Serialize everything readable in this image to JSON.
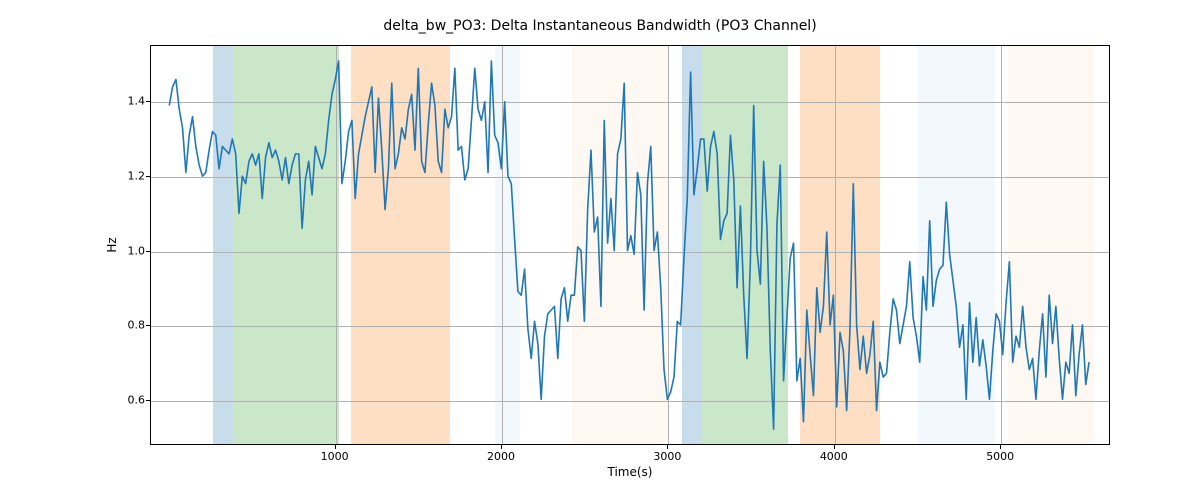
{
  "chart_data": {
    "type": "line",
    "title": "delta_bw_PO3: Delta Instantaneous Bandwidth (PO3 Channel)",
    "xlabel": "Time(s)",
    "ylabel": "Hz",
    "xlim": [
      -110,
      5660
    ],
    "ylim": [
      0.48,
      1.55
    ],
    "xticks": [
      1000,
      2000,
      3000,
      4000,
      5000
    ],
    "yticks": [
      0.6,
      0.8,
      1.0,
      1.2,
      1.4
    ],
    "bands": [
      {
        "x0": 260,
        "x1": 380,
        "color": "#1f77b4"
      },
      {
        "x0": 380,
        "x1": 1020,
        "color": "#2ca02c"
      },
      {
        "x0": 1090,
        "x1": 1690,
        "color": "#ff7f0e"
      },
      {
        "x0": 1960,
        "x1": 2110,
        "color": "#cfe4f3"
      },
      {
        "x0": 2420,
        "x1": 3000,
        "color": "#fde3cc"
      },
      {
        "x0": 3080,
        "x1": 3200,
        "color": "#1f77b4"
      },
      {
        "x0": 3200,
        "x1": 3720,
        "color": "#2ca02c"
      },
      {
        "x0": 3790,
        "x1": 4270,
        "color": "#ff7f0e"
      },
      {
        "x0": 4500,
        "x1": 4960,
        "color": "#cfe4f3"
      },
      {
        "x0": 5040,
        "x1": 5560,
        "color": "#fde3cc"
      }
    ],
    "x": [
      0,
      20,
      40,
      60,
      80,
      100,
      120,
      140,
      160,
      180,
      200,
      220,
      240,
      260,
      280,
      300,
      320,
      340,
      360,
      380,
      400,
      420,
      440,
      460,
      480,
      500,
      520,
      540,
      560,
      580,
      600,
      620,
      640,
      660,
      680,
      700,
      720,
      740,
      760,
      780,
      800,
      820,
      840,
      860,
      880,
      900,
      920,
      940,
      960,
      980,
      1000,
      1020,
      1040,
      1060,
      1080,
      1100,
      1120,
      1140,
      1160,
      1180,
      1200,
      1220,
      1240,
      1260,
      1280,
      1300,
      1320,
      1340,
      1360,
      1380,
      1400,
      1420,
      1440,
      1460,
      1480,
      1500,
      1520,
      1540,
      1560,
      1580,
      1600,
      1620,
      1640,
      1660,
      1680,
      1700,
      1720,
      1740,
      1760,
      1780,
      1800,
      1820,
      1840,
      1860,
      1880,
      1900,
      1920,
      1940,
      1960,
      1980,
      2000,
      2020,
      2040,
      2060,
      2080,
      2100,
      2120,
      2140,
      2160,
      2180,
      2200,
      2220,
      2240,
      2260,
      2280,
      2300,
      2320,
      2340,
      2360,
      2380,
      2400,
      2420,
      2440,
      2460,
      2480,
      2500,
      2520,
      2540,
      2560,
      2580,
      2600,
      2620,
      2640,
      2660,
      2680,
      2700,
      2720,
      2740,
      2760,
      2780,
      2800,
      2820,
      2840,
      2860,
      2880,
      2900,
      2920,
      2940,
      2960,
      2980,
      3000,
      3020,
      3040,
      3060,
      3080,
      3100,
      3120,
      3140,
      3160,
      3180,
      3200,
      3220,
      3240,
      3260,
      3280,
      3300,
      3320,
      3340,
      3360,
      3380,
      3400,
      3420,
      3440,
      3460,
      3480,
      3500,
      3520,
      3540,
      3560,
      3580,
      3600,
      3620,
      3640,
      3660,
      3680,
      3700,
      3720,
      3740,
      3760,
      3780,
      3800,
      3820,
      3840,
      3860,
      3880,
      3900,
      3920,
      3940,
      3960,
      3980,
      4000,
      4020,
      4040,
      4060,
      4080,
      4100,
      4120,
      4140,
      4160,
      4180,
      4200,
      4220,
      4240,
      4260,
      4280,
      4300,
      4320,
      4340,
      4360,
      4380,
      4400,
      4420,
      4440,
      4460,
      4480,
      4500,
      4520,
      4540,
      4560,
      4580,
      4600,
      4620,
      4640,
      4660,
      4680,
      4700,
      4720,
      4740,
      4760,
      4780,
      4800,
      4820,
      4840,
      4860,
      4880,
      4900,
      4920,
      4940,
      4960,
      4980,
      5000,
      5020,
      5040,
      5060,
      5080,
      5100,
      5120,
      5140,
      5160,
      5180,
      5200,
      5220,
      5240,
      5260,
      5280,
      5300,
      5320,
      5340,
      5360,
      5380,
      5400,
      5420,
      5440,
      5460,
      5480,
      5500,
      5520,
      5540
    ],
    "values": [
      1.39,
      1.44,
      1.46,
      1.38,
      1.33,
      1.21,
      1.31,
      1.36,
      1.28,
      1.23,
      1.2,
      1.21,
      1.27,
      1.32,
      1.31,
      1.22,
      1.28,
      1.27,
      1.26,
      1.3,
      1.26,
      1.1,
      1.2,
      1.18,
      1.24,
      1.26,
      1.23,
      1.26,
      1.14,
      1.25,
      1.29,
      1.25,
      1.27,
      1.24,
      1.19,
      1.25,
      1.18,
      1.23,
      1.26,
      1.26,
      1.06,
      1.19,
      1.24,
      1.15,
      1.28,
      1.25,
      1.22,
      1.26,
      1.35,
      1.42,
      1.46,
      1.51,
      1.18,
      1.24,
      1.32,
      1.35,
      1.14,
      1.26,
      1.31,
      1.36,
      1.4,
      1.44,
      1.21,
      1.41,
      1.27,
      1.11,
      1.22,
      1.45,
      1.22,
      1.26,
      1.33,
      1.3,
      1.38,
      1.42,
      1.27,
      1.49,
      1.24,
      1.21,
      1.34,
      1.45,
      1.39,
      1.24,
      1.21,
      1.38,
      1.33,
      1.36,
      1.49,
      1.27,
      1.28,
      1.19,
      1.22,
      1.35,
      1.49,
      1.38,
      1.35,
      1.4,
      1.21,
      1.51,
      1.31,
      1.29,
      1.22,
      1.4,
      1.2,
      1.18,
      1.03,
      0.89,
      0.88,
      0.95,
      0.79,
      0.71,
      0.81,
      0.75,
      0.6,
      0.77,
      0.83,
      0.84,
      0.85,
      0.71,
      0.87,
      0.9,
      0.81,
      0.88,
      0.88,
      1.01,
      1.0,
      0.81,
      1.11,
      1.27,
      1.05,
      1.09,
      0.85,
      1.35,
      1.02,
      1.14,
      1.0,
      1.26,
      1.3,
      1.45,
      1.0,
      1.04,
      0.99,
      1.21,
      1.15,
      0.84,
      1.18,
      1.28,
      1.0,
      1.05,
      0.9,
      0.68,
      0.6,
      0.62,
      0.66,
      0.81,
      0.8,
      0.98,
      1.14,
      1.48,
      1.15,
      1.22,
      1.3,
      1.3,
      1.16,
      1.28,
      1.32,
      1.26,
      1.03,
      1.08,
      1.1,
      1.31,
      1.19,
      0.9,
      1.12,
      0.88,
      0.71,
      0.97,
      1.39,
      1.0,
      0.91,
      1.24,
      1.06,
      0.73,
      0.52,
      1.07,
      1.23,
      0.65,
      0.82,
      0.98,
      1.02,
      0.65,
      0.71,
      0.54,
      0.84,
      0.72,
      0.61,
      0.9,
      0.78,
      0.85,
      1.05,
      0.8,
      0.88,
      0.58,
      0.78,
      0.73,
      0.57,
      0.79,
      1.18,
      0.8,
      0.68,
      0.77,
      0.67,
      0.72,
      0.81,
      0.57,
      0.7,
      0.66,
      0.67,
      0.78,
      0.87,
      0.84,
      0.75,
      0.8,
      0.85,
      0.97,
      0.82,
      0.77,
      0.7,
      0.93,
      0.84,
      1.08,
      0.85,
      0.92,
      0.95,
      0.96,
      1.13,
      0.99,
      0.92,
      0.85,
      0.74,
      0.8,
      0.6,
      0.86,
      0.7,
      0.82,
      0.69,
      0.76,
      0.69,
      0.6,
      0.73,
      0.83,
      0.81,
      0.72,
      0.86,
      0.97,
      0.7,
      0.77,
      0.74,
      0.85,
      0.74,
      0.68,
      0.71,
      0.6,
      0.73,
      0.83,
      0.66,
      0.88,
      0.75,
      0.85,
      0.71,
      0.6,
      0.7,
      0.67,
      0.8,
      0.61,
      0.72,
      0.8,
      0.64,
      0.7
    ]
  },
  "colors": {
    "line": "#1f77b4"
  }
}
